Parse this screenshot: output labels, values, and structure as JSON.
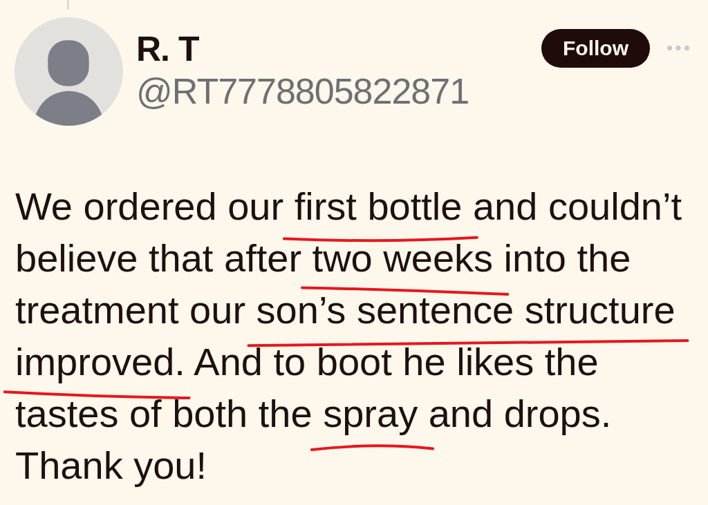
{
  "post": {
    "author": {
      "name": "R. T",
      "handle": "@RT7778805822871"
    },
    "follow_button": {
      "label": "Follow"
    },
    "text": {
      "lines": [
        {
          "segments": [
            {
              "text": "We ordered our ",
              "underlined": false
            },
            {
              "text": "first bottle",
              "underlined": true
            },
            {
              "text": " and couldn’t",
              "underlined": false
            }
          ]
        },
        {
          "segments": [
            {
              "text": "believe that after ",
              "underlined": false
            },
            {
              "text": "two weeks",
              "underlined": true
            },
            {
              "text": " into the",
              "underlined": false
            }
          ]
        },
        {
          "segments": [
            {
              "text": "treatment our ",
              "underlined": false
            },
            {
              "text": "son’s sentence structure",
              "underlined": true
            }
          ]
        },
        {
          "segments": [
            {
              "text": "improved",
              "underlined": true
            },
            {
              "text": ". And to boot he likes the",
              "underlined": false
            }
          ]
        },
        {
          "segments": [
            {
              "text": "tastes of both the ",
              "underlined": false
            },
            {
              "text": "spray",
              "underlined": true
            },
            {
              "text": " and drops.",
              "underlined": false
            }
          ]
        },
        {
          "segments": [
            {
              "text": "Thank you!",
              "underlined": false
            }
          ]
        }
      ]
    }
  }
}
